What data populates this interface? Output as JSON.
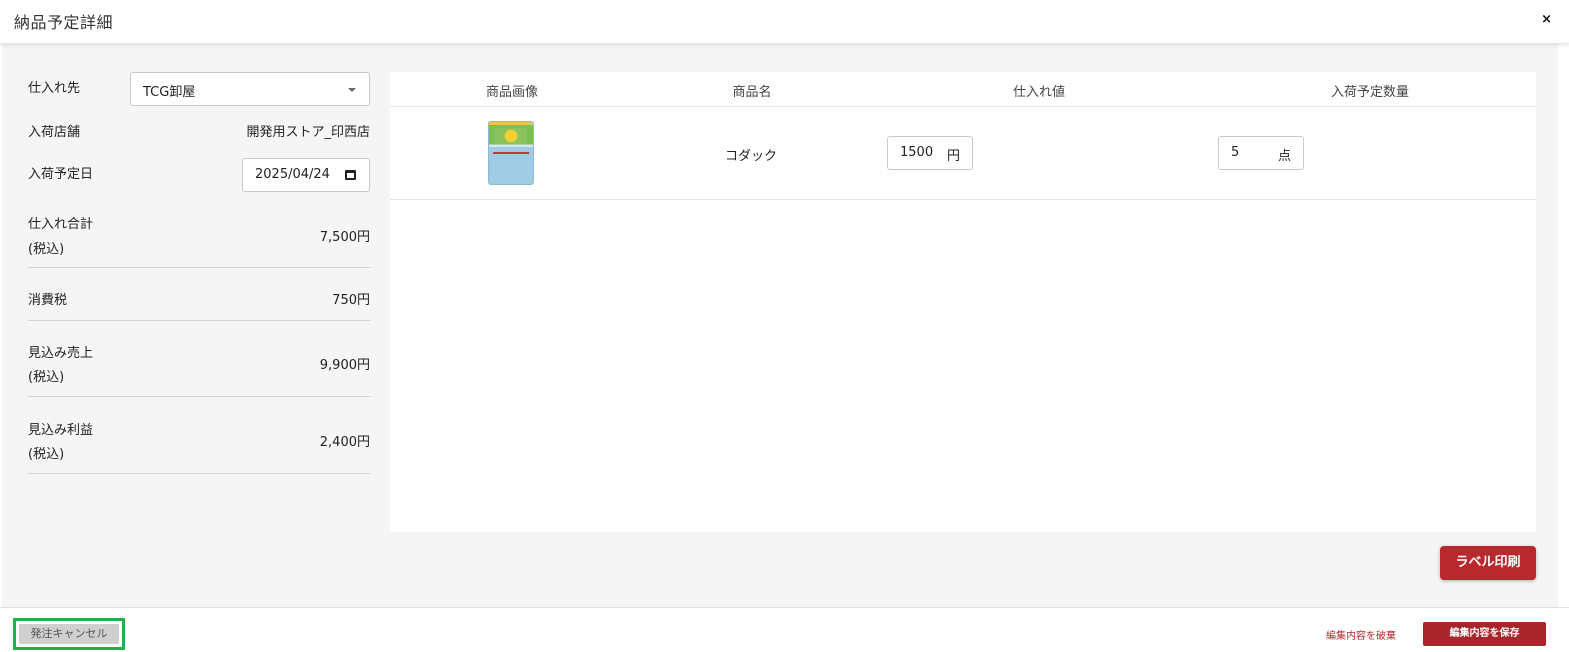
{
  "header": {
    "title": "納品予定詳細",
    "close_label": "×"
  },
  "form": {
    "supplier_label": "仕入れ先",
    "supplier_value": "TCG卸屋",
    "store_label": "入荷店舗",
    "store_value": "開発用ストア_印西店",
    "date_label": "入荷予定日",
    "date_value": "2025/04/24"
  },
  "summary": {
    "purchase_total_label_1": "仕入れ合計",
    "purchase_total_label_2": "(税込)",
    "purchase_total_value": "7,500円",
    "tax_label": "消費税",
    "tax_value": "750円",
    "expected_sales_label_1": "見込み売上",
    "expected_sales_label_2": "(税込)",
    "expected_sales_value": "9,900円",
    "expected_profit_label_1": "見込み利益",
    "expected_profit_label_2": "(税込)",
    "expected_profit_value": "2,400円"
  },
  "table": {
    "columns": [
      "商品画像",
      "商品名",
      "仕入れ値",
      "入荷予定数量"
    ],
    "rows": [
      {
        "name": "コダック",
        "price": "1500",
        "price_unit": "円",
        "quantity": "5",
        "quantity_unit": "点"
      }
    ]
  },
  "actions": {
    "label_print": "ラベル印刷",
    "order_cancel": "発注キャンセル",
    "discard_edits": "編集内容を破棄",
    "save_edits": "編集内容を保存"
  }
}
